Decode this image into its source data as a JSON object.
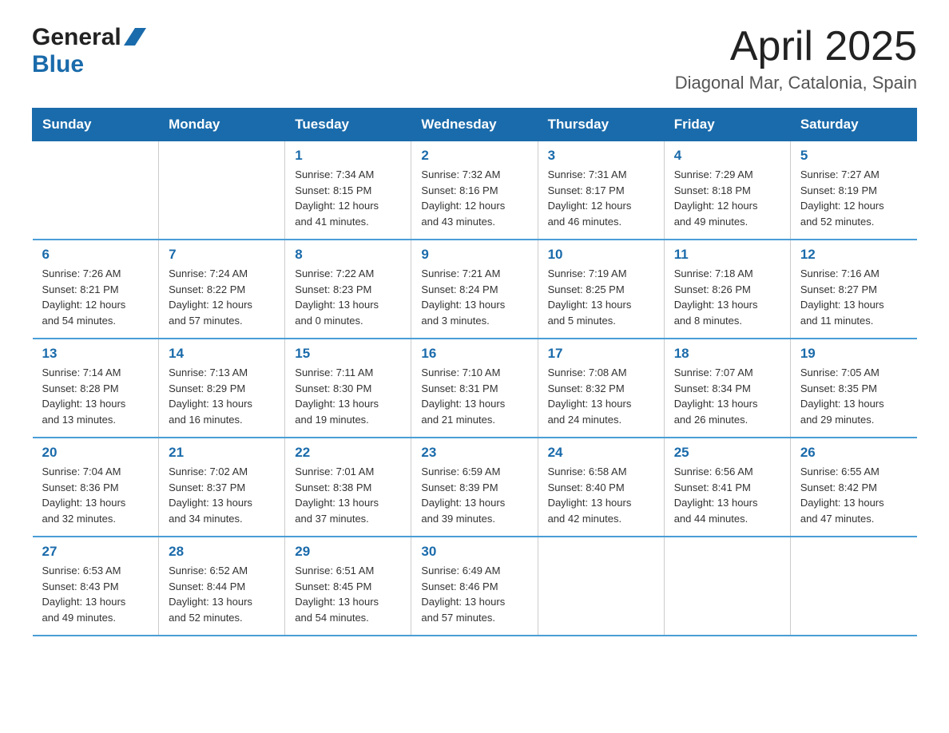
{
  "header": {
    "logo_general": "General",
    "logo_blue": "Blue",
    "title": "April 2025",
    "subtitle": "Diagonal Mar, Catalonia, Spain"
  },
  "days_of_week": [
    "Sunday",
    "Monday",
    "Tuesday",
    "Wednesday",
    "Thursday",
    "Friday",
    "Saturday"
  ],
  "weeks": [
    [
      {
        "day": "",
        "info": ""
      },
      {
        "day": "",
        "info": ""
      },
      {
        "day": "1",
        "info": "Sunrise: 7:34 AM\nSunset: 8:15 PM\nDaylight: 12 hours\nand 41 minutes."
      },
      {
        "day": "2",
        "info": "Sunrise: 7:32 AM\nSunset: 8:16 PM\nDaylight: 12 hours\nand 43 minutes."
      },
      {
        "day": "3",
        "info": "Sunrise: 7:31 AM\nSunset: 8:17 PM\nDaylight: 12 hours\nand 46 minutes."
      },
      {
        "day": "4",
        "info": "Sunrise: 7:29 AM\nSunset: 8:18 PM\nDaylight: 12 hours\nand 49 minutes."
      },
      {
        "day": "5",
        "info": "Sunrise: 7:27 AM\nSunset: 8:19 PM\nDaylight: 12 hours\nand 52 minutes."
      }
    ],
    [
      {
        "day": "6",
        "info": "Sunrise: 7:26 AM\nSunset: 8:21 PM\nDaylight: 12 hours\nand 54 minutes."
      },
      {
        "day": "7",
        "info": "Sunrise: 7:24 AM\nSunset: 8:22 PM\nDaylight: 12 hours\nand 57 minutes."
      },
      {
        "day": "8",
        "info": "Sunrise: 7:22 AM\nSunset: 8:23 PM\nDaylight: 13 hours\nand 0 minutes."
      },
      {
        "day": "9",
        "info": "Sunrise: 7:21 AM\nSunset: 8:24 PM\nDaylight: 13 hours\nand 3 minutes."
      },
      {
        "day": "10",
        "info": "Sunrise: 7:19 AM\nSunset: 8:25 PM\nDaylight: 13 hours\nand 5 minutes."
      },
      {
        "day": "11",
        "info": "Sunrise: 7:18 AM\nSunset: 8:26 PM\nDaylight: 13 hours\nand 8 minutes."
      },
      {
        "day": "12",
        "info": "Sunrise: 7:16 AM\nSunset: 8:27 PM\nDaylight: 13 hours\nand 11 minutes."
      }
    ],
    [
      {
        "day": "13",
        "info": "Sunrise: 7:14 AM\nSunset: 8:28 PM\nDaylight: 13 hours\nand 13 minutes."
      },
      {
        "day": "14",
        "info": "Sunrise: 7:13 AM\nSunset: 8:29 PM\nDaylight: 13 hours\nand 16 minutes."
      },
      {
        "day": "15",
        "info": "Sunrise: 7:11 AM\nSunset: 8:30 PM\nDaylight: 13 hours\nand 19 minutes."
      },
      {
        "day": "16",
        "info": "Sunrise: 7:10 AM\nSunset: 8:31 PM\nDaylight: 13 hours\nand 21 minutes."
      },
      {
        "day": "17",
        "info": "Sunrise: 7:08 AM\nSunset: 8:32 PM\nDaylight: 13 hours\nand 24 minutes."
      },
      {
        "day": "18",
        "info": "Sunrise: 7:07 AM\nSunset: 8:34 PM\nDaylight: 13 hours\nand 26 minutes."
      },
      {
        "day": "19",
        "info": "Sunrise: 7:05 AM\nSunset: 8:35 PM\nDaylight: 13 hours\nand 29 minutes."
      }
    ],
    [
      {
        "day": "20",
        "info": "Sunrise: 7:04 AM\nSunset: 8:36 PM\nDaylight: 13 hours\nand 32 minutes."
      },
      {
        "day": "21",
        "info": "Sunrise: 7:02 AM\nSunset: 8:37 PM\nDaylight: 13 hours\nand 34 minutes."
      },
      {
        "day": "22",
        "info": "Sunrise: 7:01 AM\nSunset: 8:38 PM\nDaylight: 13 hours\nand 37 minutes."
      },
      {
        "day": "23",
        "info": "Sunrise: 6:59 AM\nSunset: 8:39 PM\nDaylight: 13 hours\nand 39 minutes."
      },
      {
        "day": "24",
        "info": "Sunrise: 6:58 AM\nSunset: 8:40 PM\nDaylight: 13 hours\nand 42 minutes."
      },
      {
        "day": "25",
        "info": "Sunrise: 6:56 AM\nSunset: 8:41 PM\nDaylight: 13 hours\nand 44 minutes."
      },
      {
        "day": "26",
        "info": "Sunrise: 6:55 AM\nSunset: 8:42 PM\nDaylight: 13 hours\nand 47 minutes."
      }
    ],
    [
      {
        "day": "27",
        "info": "Sunrise: 6:53 AM\nSunset: 8:43 PM\nDaylight: 13 hours\nand 49 minutes."
      },
      {
        "day": "28",
        "info": "Sunrise: 6:52 AM\nSunset: 8:44 PM\nDaylight: 13 hours\nand 52 minutes."
      },
      {
        "day": "29",
        "info": "Sunrise: 6:51 AM\nSunset: 8:45 PM\nDaylight: 13 hours\nand 54 minutes."
      },
      {
        "day": "30",
        "info": "Sunrise: 6:49 AM\nSunset: 8:46 PM\nDaylight: 13 hours\nand 57 minutes."
      },
      {
        "day": "",
        "info": ""
      },
      {
        "day": "",
        "info": ""
      },
      {
        "day": "",
        "info": ""
      }
    ]
  ],
  "colors": {
    "header_bg": "#1a6bab",
    "header_text": "#ffffff",
    "day_number": "#1a6bab",
    "border": "#4a9ed6"
  }
}
